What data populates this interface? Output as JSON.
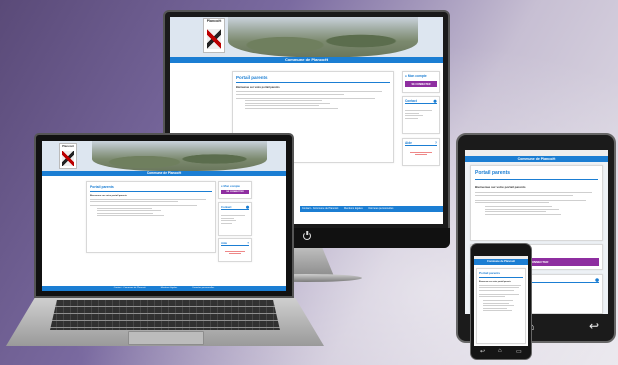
{
  "site": {
    "town_logo": "Plancoët",
    "banner": "Commune de Plancoët",
    "portal_title": "Portail parents",
    "welcome": "Bienvenue sur votre portail parents",
    "account_title": "Mon compte",
    "connect_label": "SE CONNECTER",
    "contact_title": "Contact",
    "aide_title": "Aide",
    "footer": [
      "Contact - Commune de Plancoët",
      "Mentions légales",
      "Données personnelles"
    ]
  },
  "colors": {
    "accent": "#1b7ed3",
    "button": "#8e2ea0",
    "error": "#d33333"
  },
  "icons": {
    "account": "user-icon",
    "contact": "map-pin-icon",
    "aide": "help-icon",
    "power": "power-icon",
    "home": "home-icon",
    "back": "back-icon"
  }
}
